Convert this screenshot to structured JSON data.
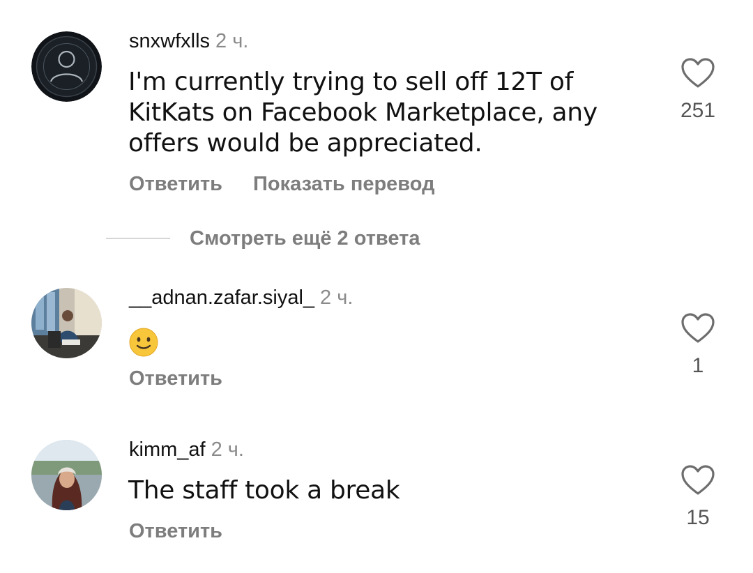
{
  "comments": [
    {
      "username": "snxwfxlls",
      "time": "2 ч.",
      "text_lines": [
        "I'm currently trying to sell off 12T of",
        "KitKats on Facebook Marketplace, any",
        "offers would be appreciated."
      ],
      "reply_label": "Ответить",
      "translate_label": "Показать перевод",
      "likes": "251",
      "avatar_icon": "default-user-avatar-icon"
    },
    {
      "username": "__adnan.zafar.siyal_",
      "time": "2 ч.",
      "emoji": "slightly-smiling-face-emoji",
      "reply_label": "Ответить",
      "likes": "1"
    },
    {
      "username": "kimm_af",
      "time": "2 ч.",
      "text": "The staff took a break",
      "reply_label": "Ответить",
      "likes": "15"
    }
  ],
  "view_replies_label": "Смотреть ещё 2 ответа",
  "icons": {
    "like": "heart-outline-icon"
  },
  "colors": {
    "secondary_text": "#7d7d7d",
    "primary_text": "#111111",
    "divider": "#d6d6d6"
  }
}
